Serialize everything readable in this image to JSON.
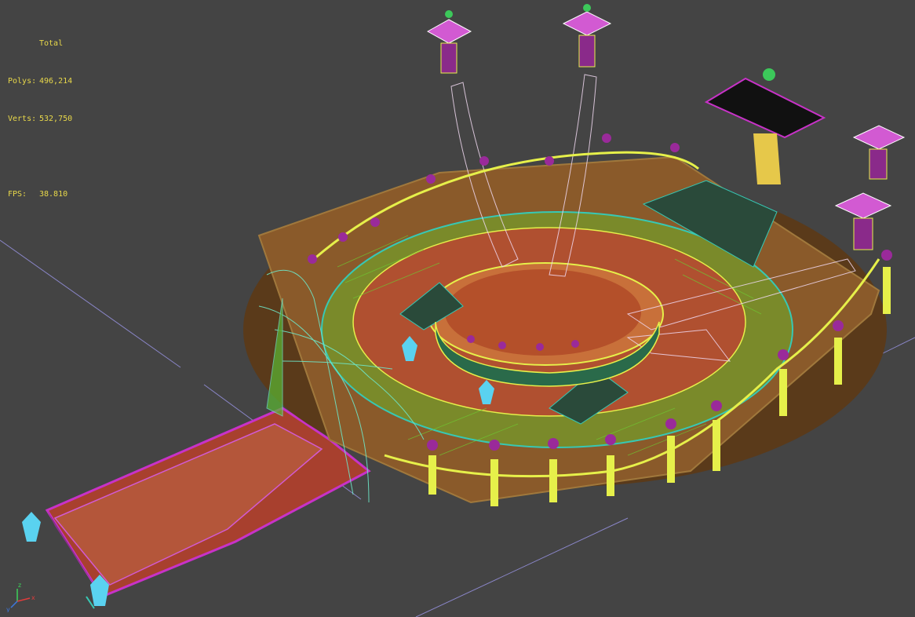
{
  "stats": {
    "title": "Total",
    "polys_label": "Polys:",
    "polys_value": "496,214",
    "verts_label": "Verts:",
    "verts_value": "532,750",
    "fps_label": "FPS:",
    "fps_value": "38.810"
  },
  "gizmo": {
    "x": "x",
    "y": "y",
    "z": "z"
  },
  "colors": {
    "background": "#444444",
    "stats_text": "#e8d84a",
    "wire_yellow": "#e6f04a",
    "wire_cyan": "#37c8b4",
    "wire_magenta": "#c832c8",
    "floor_red": "#9a3a2a",
    "grid_line": "#8a86c8"
  }
}
